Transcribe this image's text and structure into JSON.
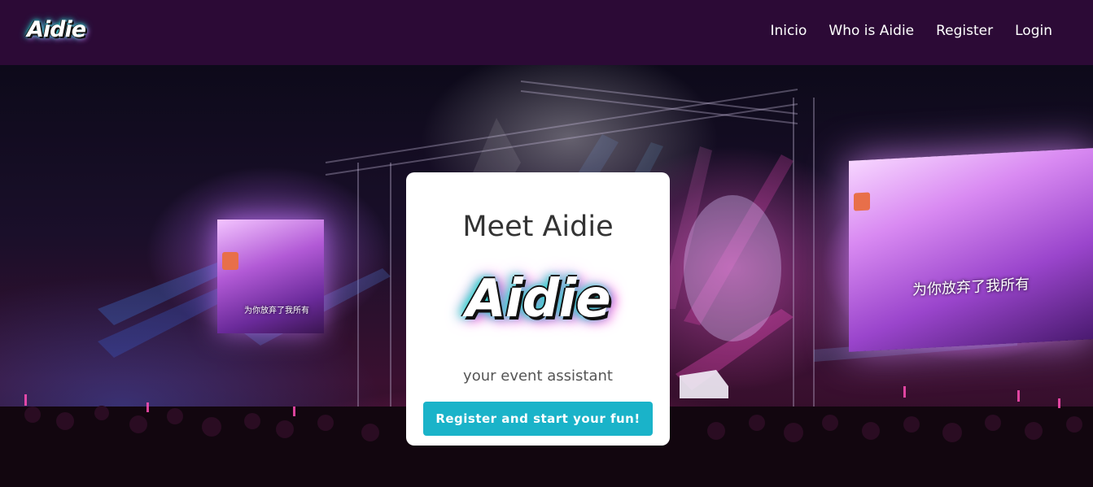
{
  "navbar": {
    "logo_text": "Aidie",
    "links": [
      {
        "label": "Inicio"
      },
      {
        "label": "Who is Aidie"
      },
      {
        "label": "Register"
      },
      {
        "label": "Login"
      }
    ]
  },
  "hero": {
    "screen_left_caption": "为你放弃了我所有",
    "screen_right_caption": "为你放弃了我所有"
  },
  "card": {
    "title": "Meet Aidie",
    "logo_text": "Aidie",
    "subtitle": "your event assistant",
    "cta_label": "Register and start your fun!"
  },
  "colors": {
    "navbar_bg": "#2c0a36",
    "cta_bg": "#1ab3c9",
    "logo_glow_cyan": "#22e6d3",
    "logo_glow_pink": "#e03ad0"
  }
}
